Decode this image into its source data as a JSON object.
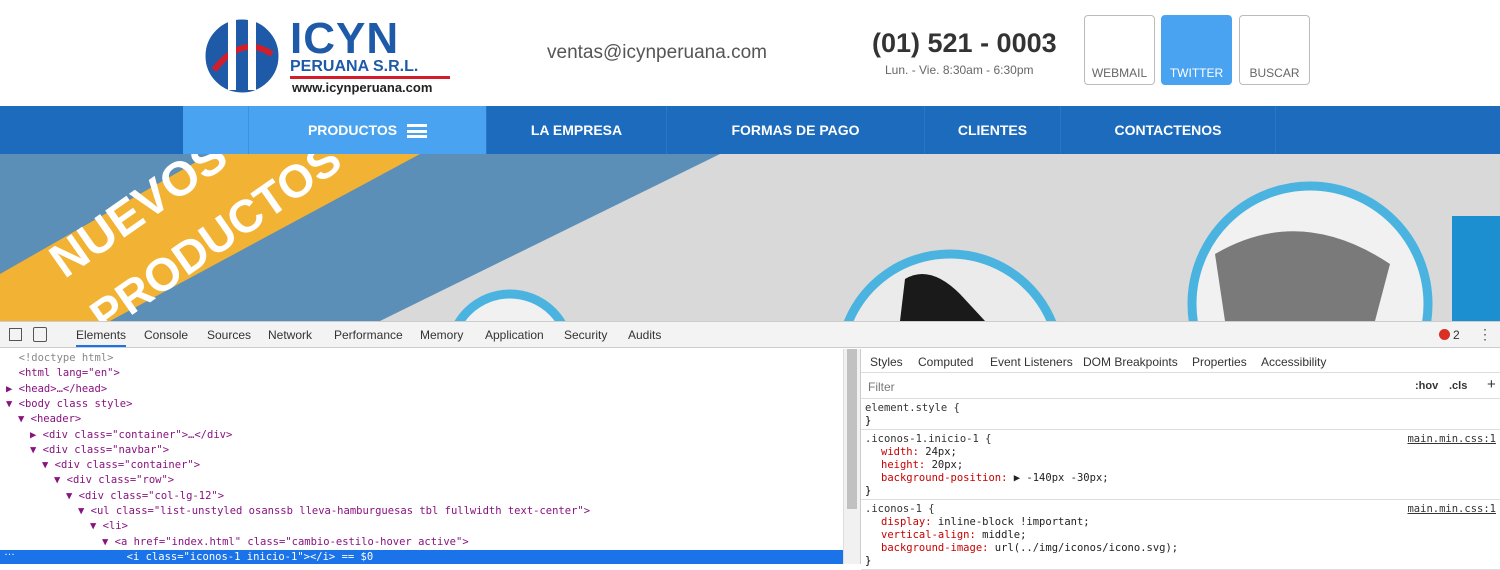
{
  "site": {
    "logo": {
      "name": "ICYN",
      "sub": "PERUANA S.R.L.",
      "url": "www.icynperuana.com"
    },
    "email": "ventas@icynperuana.com",
    "phone": "(01) 521 - 0003",
    "hours": "Lun. - Vie. 8:30am - 6:30pm",
    "buttons": [
      "WEBMAIL",
      "TWITTER",
      "BUSCAR"
    ],
    "nav": [
      "PRODUCTOS",
      "LA EMPRESA",
      "FORMAS DE PAGO",
      "CLIENTES",
      "CONTACTENOS"
    ],
    "banner_text": [
      "NUEVOS",
      "PRODUCTOS"
    ]
  },
  "devtools": {
    "tabs": [
      "Elements",
      "Console",
      "Sources",
      "Network",
      "Performance",
      "Memory",
      "Application",
      "Security",
      "Audits"
    ],
    "error_count": "2",
    "dom": [
      {
        "indent": 0,
        "arrow": "",
        "text": "<!doctype html>"
      },
      {
        "indent": 0,
        "arrow": "",
        "text": "<html lang=\"en\">"
      },
      {
        "indent": 0,
        "arrow": "▶",
        "text": "<head>…</head>"
      },
      {
        "indent": 0,
        "arrow": "▼",
        "text": "<body class style>"
      },
      {
        "indent": 1,
        "arrow": "▼",
        "text": "<header>"
      },
      {
        "indent": 2,
        "arrow": "▶",
        "text": "<div class=\"container\">…</div>"
      },
      {
        "indent": 2,
        "arrow": "▼",
        "text": "<div class=\"navbar\">"
      },
      {
        "indent": 3,
        "arrow": "▼",
        "text": "<div class=\"container\">"
      },
      {
        "indent": 4,
        "arrow": "▼",
        "text": "<div class=\"row\">"
      },
      {
        "indent": 5,
        "arrow": "▼",
        "text": "<div class=\"col-lg-12\">"
      },
      {
        "indent": 6,
        "arrow": "▼",
        "text": "<ul class=\"list-unstyled osanssb lleva-hamburguesas tbl fullwidth text-center\">"
      },
      {
        "indent": 7,
        "arrow": "▼",
        "text": "<li>"
      },
      {
        "indent": 8,
        "arrow": "▼",
        "text": "<a href=\"index.html\" class=\"cambio-estilo-hover active\">"
      },
      {
        "indent": 9,
        "arrow": "",
        "text": "<i class=\"iconos-1 inicio-1\"></i> == $0",
        "selected": true
      }
    ],
    "styles_tabs": [
      "Styles",
      "Computed",
      "Event Listeners",
      "DOM Breakpoints",
      "Properties",
      "Accessibility"
    ],
    "filter_placeholder": "Filter",
    "hov": ":hov",
    "cls": ".cls",
    "rules": [
      {
        "selector": "element.style {",
        "props": [],
        "source": ""
      },
      {
        "selector": ".iconos-1.inicio-1 {",
        "source": "main.min.css:1",
        "props": [
          [
            "width",
            "24px;"
          ],
          [
            "height",
            "20px;"
          ],
          [
            "background-position",
            "▶ -140px -30px;"
          ]
        ]
      },
      {
        "selector": ".iconos-1 {",
        "source": "main.min.css:1",
        "props": [
          [
            "display",
            "inline-block !important;"
          ],
          [
            "vertical-align",
            "middle;"
          ],
          [
            "background-image",
            "url(../img/iconos/icono.svg);"
          ]
        ]
      }
    ]
  }
}
